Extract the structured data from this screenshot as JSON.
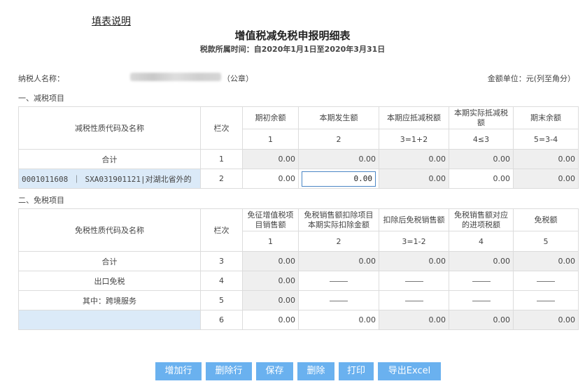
{
  "help_link": "填表说明",
  "title": "增值税减免税申报明细表",
  "period": "税款所属时间：自2020年1月1日至2020年3月31日",
  "taxpayer_label": "纳税人名称：",
  "taxpayer_seal": "（公章）",
  "unit": "金额单位：元(列至角分）",
  "reduction": {
    "section_title": "一、减税项目",
    "headers": {
      "name": "减税性质代码及名称",
      "row_no": "栏次",
      "cols": [
        "期初余额",
        "本期发生额",
        "本期应抵减税额",
        "本期实际抵减税额",
        "期末余额"
      ],
      "col_nums": [
        "1",
        "2",
        "3=1+2",
        "4≤3",
        "5=3-4"
      ]
    },
    "rows": [
      {
        "name": "合计",
        "row_no": "1",
        "values": [
          "0.00",
          "0.00",
          "0.00",
          "0.00",
          "0.00"
        ]
      },
      {
        "code": "0001011608 ｜ SXA031901121|对湖北省外的",
        "row_no": "2",
        "values": [
          "0.00",
          "0.00",
          "0.00",
          "0.00",
          "0.00"
        ]
      }
    ]
  },
  "exemption": {
    "section_title": "二、免税项目",
    "headers": {
      "name": "免税性质代码及名称",
      "row_no": "栏次",
      "cols": [
        "免征增值税项目销售额",
        "免税销售额扣除项目本期实际扣除金额",
        "扣除后免税销售额",
        "免税销售额对应的进项税额",
        "免税额"
      ],
      "col_nums": [
        "1",
        "2",
        "3=1-2",
        "4",
        "5"
      ]
    },
    "rows": [
      {
        "name": "合计",
        "row_no": "3",
        "values": [
          "0.00",
          "0.00",
          "0.00",
          "0.00",
          "0.00"
        ]
      },
      {
        "name": "出口免税",
        "row_no": "4",
        "values": [
          "0.00"
        ]
      },
      {
        "name": "其中：跨境服务",
        "row_no": "5",
        "values": [
          "0.00"
        ]
      },
      {
        "name": "",
        "row_no": "6",
        "values": [
          "0.00",
          "0.00",
          "0.00",
          "0.00",
          "0.00"
        ]
      }
    ]
  },
  "buttons": {
    "add_row": "增加行",
    "delete_row": "删除行",
    "save": "保存",
    "delete": "删除",
    "print": "打印",
    "export_excel": "导出Excel"
  }
}
